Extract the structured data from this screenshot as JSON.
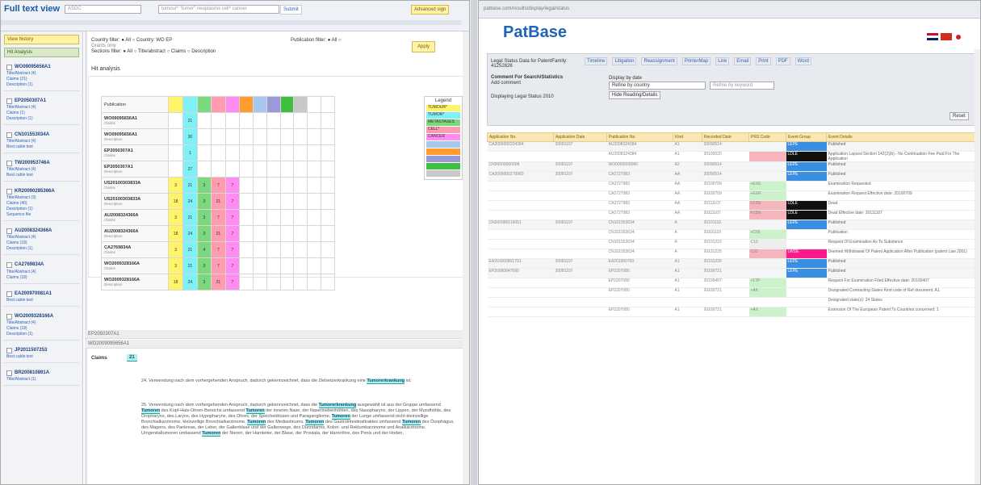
{
  "left": {
    "title": "Full text view",
    "lang_select": "ASDC",
    "search_placeholder": "tumour* \"tumor\" neoplasms cell* cancer",
    "submit_label": "Submit",
    "advanced_label": "Advanced sign",
    "view_history": "View history",
    "hit_analysis_button": "Hit Analysis",
    "country_filter": "Country filter: ● All ○ Country: WO EP",
    "grants_only": "Grants only",
    "sections_filter": "Sections filter: ● All ○ Title/abstract ○ Claims ○ Description",
    "publication_filter": "Publication filter: ● All ○",
    "apply_label": "Apply",
    "hit_analysis_title": "Hit analysis",
    "pub_header": "Publication",
    "docs": [
      {
        "id": "WO09095656A1",
        "lines": [
          "Title/Abstract (4)",
          "Claims (21) ",
          "Description (1)"
        ]
      },
      {
        "id": "EP2050307A1",
        "lines": [
          "Title/Abstract (4)",
          "Claims (1) ",
          "Description (1)"
        ]
      },
      {
        "id": "CN101553034A",
        "lines": [
          "Title/Abstract (4)",
          "Best cable text"
        ]
      },
      {
        "id": "TW200953746A",
        "lines": [
          "Title/Abstract (4)",
          "Best cable text"
        ]
      },
      {
        "id": "KR20090285366A",
        "lines": [
          "Title/Abstract (3)",
          "Claims (40) ",
          "Description (1)",
          "Sequence file"
        ]
      },
      {
        "id": "AU2008324366A",
        "lines": [
          "Title/Abstract (4)",
          "Claims (18)",
          "Description (1)"
        ]
      },
      {
        "id": "CA2769834A",
        "lines": [
          "Title/Abstract (4)",
          "Claims (18)"
        ]
      },
      {
        "id": "EA200970081A1",
        "lines": [
          "Best cable text"
        ]
      },
      {
        "id": "WO2009328166A",
        "lines": [
          "Title/Abstract (4)",
          "Claims (18)",
          "Description (1)"
        ]
      },
      {
        "id": "JP2011507253",
        "lines": [
          "Best cable text"
        ]
      },
      {
        "id": "BR200810891A",
        "lines": [
          "Title/Abstract (1)"
        ]
      }
    ],
    "hit_rows": [
      {
        "pub": "WO09095656A1",
        "type": "Claims",
        "cells": [
          "",
          "21",
          "",
          "",
          "",
          "",
          "",
          "",
          "",
          "",
          "",
          ""
        ]
      },
      {
        "pub": "WO09095656A1",
        "type": "Description",
        "cells": [
          "",
          "36",
          "",
          "",
          "",
          "",
          "",
          "",
          "",
          "",
          "",
          ""
        ]
      },
      {
        "pub": "EP2050307A1",
        "type": "Claims",
        "cells": [
          "",
          "1",
          "",
          "",
          "",
          "",
          "",
          "",
          "",
          "",
          "",
          ""
        ]
      },
      {
        "pub": "EP2050307A1",
        "type": "Description",
        "cells": [
          "",
          "27",
          "",
          "",
          "",
          "",
          "",
          "",
          "",
          "",
          "",
          ""
        ]
      },
      {
        "pub": "US20100303833A",
        "type": "Claims",
        "cells": [
          "3",
          "21",
          "3",
          "7",
          "7",
          "",
          "",
          "",
          "",
          "",
          "",
          ""
        ]
      },
      {
        "pub": "US20100303833A",
        "type": "Description",
        "cells": [
          "18",
          "24",
          "3",
          "21",
          "7",
          "",
          "",
          "",
          "",
          "",
          "",
          ""
        ]
      },
      {
        "pub": "AU2008324366A",
        "type": "Claims",
        "cells": [
          "3",
          "21",
          "3",
          "7",
          "7",
          "",
          "",
          "",
          "",
          "",
          "",
          ""
        ]
      },
      {
        "pub": "AU2008324366A",
        "type": "Description",
        "cells": [
          "18",
          "24",
          "3",
          "21",
          "7",
          "",
          "",
          "",
          "",
          "",
          "",
          ""
        ]
      },
      {
        "pub": "CA2769834A",
        "type": "Claims",
        "cells": [
          "3",
          "21",
          "4",
          "7",
          "7",
          "",
          "",
          "",
          "",
          "",
          "",
          ""
        ]
      },
      {
        "pub": "WO2009328166A",
        "type": "Claims",
        "cells": [
          "3",
          "21",
          "3",
          "7",
          "7",
          "",
          "",
          "",
          "",
          "",
          "",
          ""
        ]
      },
      {
        "pub": "WO2009328166A",
        "type": "Description",
        "cells": [
          "18",
          "24",
          "3",
          "21",
          "7",
          "",
          "",
          "",
          "",
          "",
          "",
          ""
        ]
      }
    ],
    "col_colors": [
      "#fff36a",
      "#7ff0f6",
      "#7cd87c",
      "#ff9cb0",
      "#ff8cf0",
      "#ff9b2f",
      "#a7c7ef",
      "#9a9ad8",
      "#3fbf3f",
      "#c8c8c8",
      "#ffffff",
      "#ffffff"
    ],
    "legend_title": "Legend",
    "legend": [
      {
        "label": "TUMOUR*",
        "color": "#fff36a"
      },
      {
        "label": "TUMOR*",
        "color": "#7ff0f6"
      },
      {
        "label": "METASTASES",
        "color": "#7cd87c"
      },
      {
        "label": "CELL*",
        "color": "#ff9cb0"
      },
      {
        "label": "CANCER",
        "color": "#ff8cf0"
      },
      {
        "label": "",
        "color": "#a7c7ef"
      },
      {
        "label": "",
        "color": "#ff9b2f"
      },
      {
        "label": "",
        "color": "#9a9ad8"
      },
      {
        "label": "",
        "color": "#3fbf3f"
      },
      {
        "label": "",
        "color": "#c8c8c8"
      }
    ],
    "stripe1": "EP2050307A1",
    "stripe2": "WO2009095656A1",
    "claims_label": "Claims",
    "claims_count": "21",
    "para1": "24. Verwendung nach dem vorhergehenden Anspruch, dadurch gekennzeichnet, dass die Zielsetzerkrankung eine Tumorerkrankung ist.",
    "para2": "25. Verwendung nach dem vorhergehenden Anspruch, dadurch gekennzeichnet, dass die Tumorerkrankung ausgewählt ist aus der Gruppe umfassend Tumoren des Kopf-Hals-Ohren-Bereichs umfassend Tumoren der inneren Nase, der Nasennebenhöhlen, des Nasopharynx, der Lippen, der Mundhöhle, des Oropharynx, des Larynx, des Hypopharynx, des Ohres, der Speicheldrüsen und Paragangliome, Tumoren der Lunge umfassend nicht-kleinzellige Bronchialkarzinome, kleinzellige Bronchialkarzinome, Tumoren des Mediastinums, Tumoren des Gastrointestinaltraktes umfassend Tumoren des Ösophagus, des Magens, des Pankreas, der Leber, der Gallenblase und der Gallenwege, des Dünndarms, Kolon- und Rektumkarzinome und Analkarzinome, Urogenitaltumoren umfassend Tumoren der Nieren, der Harnleiter, der Blase, der Prostata, der Harnröhre, des Penis und der Hoden,"
  },
  "right": {
    "url": "patbase.com/results/display/legal/status",
    "logo": "PatBase",
    "legal_title": "Legal Status Data for PatentFamily: 41252826",
    "comment_label": "Comment For Search/Statistics",
    "comment_sub": "Add comment",
    "display_label": "Display by date",
    "refine_label": "Refine by country",
    "refine_placeholder": "Refine by keyword",
    "hide_btn": "Hide Reading/Details",
    "checkbox_text": "Displaying Legal Status 2010",
    "reset_label": "Reset",
    "tools": [
      "Timeline",
      "Litigation",
      "Reassignment",
      "PrinterMap",
      "Link",
      "Email",
      "Print",
      "PDF",
      "Word"
    ],
    "headers": [
      "Application No.",
      "Application Date",
      "Publication No.",
      "Kind",
      "Recorded Date",
      "PRS Code",
      "Event Group",
      "Event Details"
    ],
    "rows": [
      {
        "g": true,
        "cells": [
          "CA2009000324384",
          "20081107",
          "AU2008324384",
          "A1",
          "20090514",
          "",
          "LEPE",
          "Published"
        ],
        "code": "",
        "ev": "#3b8fe0"
      },
      {
        "g": false,
        "cells": [
          "",
          "",
          "AU2008324384",
          "A1",
          "20100520",
          "",
          "LDLE",
          "Application Lapsed Section 142(2)(b) - No Continuation Fee Paid For The Application"
        ],
        "code": "#f6b4bc",
        "ev": "#111111"
      },
      {
        "g": true,
        "cells": [
          "CN00000000008",
          "20081107",
          "WO0000000080",
          "A2",
          "20090514",
          "",
          "LEPE",
          "Published"
        ],
        "code": "",
        "ev": "#3b8fe0"
      },
      {
        "g": true,
        "cells": [
          "CA2009000279983",
          "20081107",
          "CA2727983",
          "AA",
          "20090514",
          "",
          "LEPE",
          "Published"
        ],
        "code": "",
        "ev": "#3b8fe0"
      },
      {
        "g": false,
        "cells": [
          "",
          "",
          "CA2727983",
          "AA",
          "20100709",
          "+EXE",
          "",
          "Examination Requested"
        ],
        "code": "#cbf2cb",
        "ev": ""
      },
      {
        "g": false,
        "cells": [
          "",
          "",
          "CA2727983",
          "AA",
          "20100709",
          "+EXR",
          "",
          "Examination Request Effective date: 20100709"
        ],
        "code": "#cbf2cb",
        "ev": ""
      },
      {
        "g": false,
        "cells": [
          "",
          "",
          "CA2727983",
          "AA",
          "20111107",
          "FZDE",
          "LDLE",
          "Dead"
        ],
        "code": "#f6b4bc",
        "ev": "#111111"
      },
      {
        "g": false,
        "cells": [
          "",
          "",
          "CA2727983",
          "AA",
          "20111107",
          "FZDE",
          "LDLE",
          "Dead Effective date: 20111107"
        ],
        "code": "#f6b4bc",
        "ev": "#111111"
      },
      {
        "g": true,
        "cells": [
          "CN200980116051",
          "20081107",
          "CN101553034",
          "A",
          "20101110",
          "",
          "LEPE",
          "Published"
        ],
        "code": "",
        "ev": "#3b8fe0"
      },
      {
        "g": false,
        "cells": [
          "",
          "",
          "CN101553034",
          "A",
          "20101110",
          "+C05",
          "",
          "Publication"
        ],
        "code": "#cbf2cb",
        "ev": ""
      },
      {
        "g": false,
        "cells": [
          "",
          "",
          "CN101553034",
          "A",
          "20101222",
          "C10",
          "",
          "Request Of Examination As To Substance"
        ],
        "code": "#eeeeee",
        "ev": ""
      },
      {
        "g": false,
        "cells": [
          "",
          "",
          "CN101553034",
          "A",
          "20131225",
          "C02",
          "LWDE",
          "Deemed Withdrawal Of Patent Application After Publication (patent Law 2001)"
        ],
        "code": "#f6b4bc",
        "ev": "#ff1a8c"
      },
      {
        "g": true,
        "cells": [
          "EA201000801791",
          "20081107",
          "EA201000793",
          "A1",
          "20101230",
          "",
          "LEPE",
          "Published"
        ],
        "code": "",
        "ev": "#3b8fe0"
      },
      {
        "g": true,
        "cells": [
          "EP20080847590",
          "20081107",
          "EP2207080",
          "A1",
          "20100721",
          "",
          "LEPE",
          "Published"
        ],
        "code": "",
        "ev": "#3b8fe0"
      },
      {
        "g": false,
        "cells": [
          "",
          "",
          "EP2207080",
          "A1",
          "20100407",
          "+17P",
          "",
          "Request For Examination Filed Effective date: 20100407"
        ],
        "code": "#cbf2cb",
        "ev": ""
      },
      {
        "g": false,
        "cells": [
          "",
          "",
          "EP2207080",
          "A1",
          "20100721",
          "+AK",
          "",
          "Designated Contracting States Kind code of Ref document: A1"
        ],
        "code": "#cbf2cb",
        "ev": ""
      },
      {
        "g": false,
        "cells": [
          "",
          "",
          "",
          "",
          "",
          "",
          "",
          "Designated state(s): 24 States"
        ],
        "code": "",
        "ev": ""
      },
      {
        "g": false,
        "cells": [
          "",
          "",
          "EP2207080",
          "A1",
          "20100721",
          "+AX",
          "",
          "Extension Of The European Patent To Countries concerned: 1"
        ],
        "code": "#cbf2cb",
        "ev": ""
      }
    ]
  }
}
